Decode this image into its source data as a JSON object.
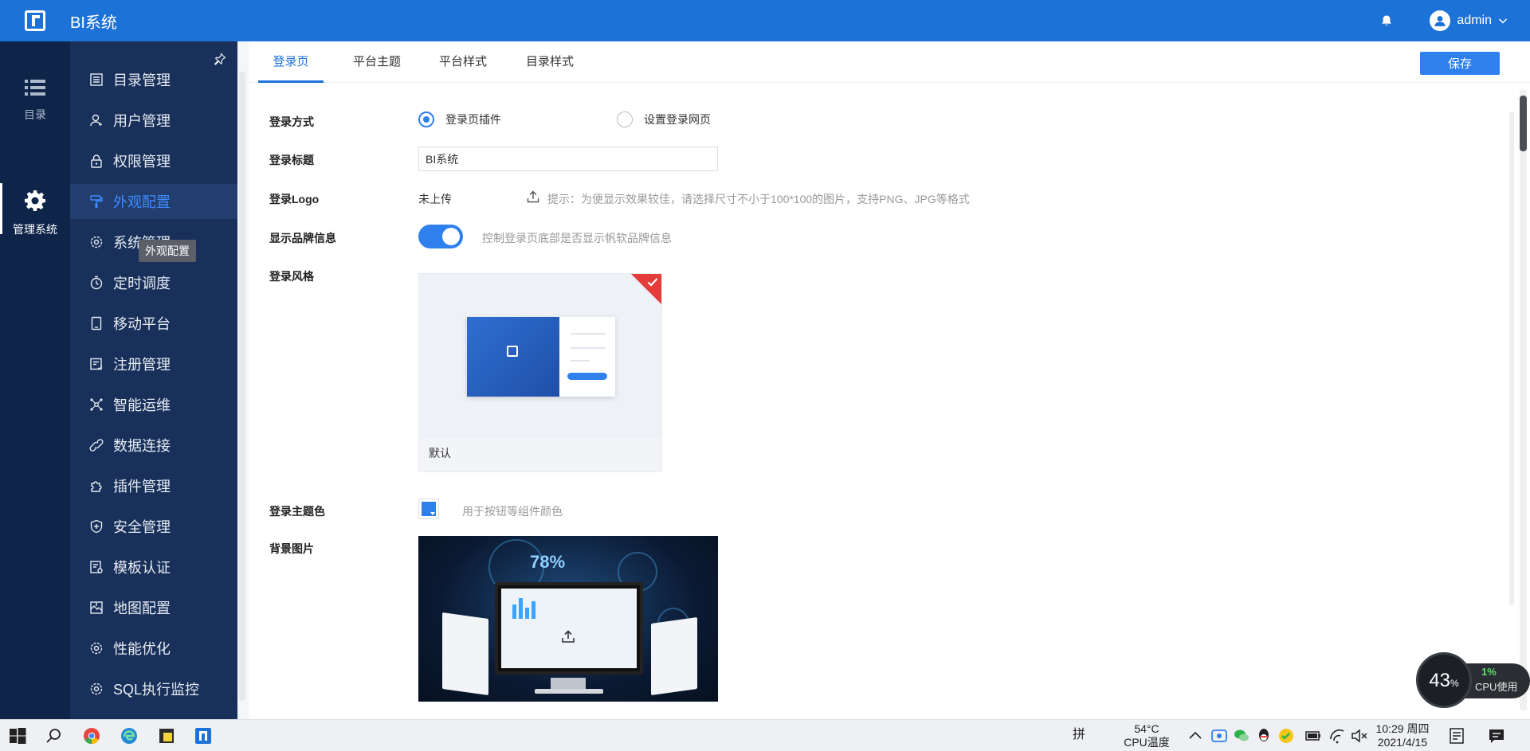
{
  "header": {
    "app_title": "BI系统",
    "user_name": "admin"
  },
  "rail": {
    "items": [
      {
        "label": "目录",
        "icon": "list-icon"
      },
      {
        "label": "管理系统",
        "icon": "gear-icon"
      }
    ]
  },
  "submenu": {
    "items": [
      {
        "label": "目录管理",
        "icon": "catalog-icon"
      },
      {
        "label": "用户管理",
        "icon": "user-icon"
      },
      {
        "label": "权限管理",
        "icon": "lock-icon"
      },
      {
        "label": "外观配置",
        "icon": "brush-icon"
      },
      {
        "label": "系统管理",
        "icon": "gear-icon"
      },
      {
        "label": "定时调度",
        "icon": "timer-icon"
      },
      {
        "label": "移动平台",
        "icon": "mobile-icon"
      },
      {
        "label": "注册管理",
        "icon": "register-icon"
      },
      {
        "label": "智能运维",
        "icon": "network-icon"
      },
      {
        "label": "数据连接",
        "icon": "link-icon"
      },
      {
        "label": "插件管理",
        "icon": "plugin-icon"
      },
      {
        "label": "安全管理",
        "icon": "shield-icon"
      },
      {
        "label": "模板认证",
        "icon": "template-icon"
      },
      {
        "label": "地图配置",
        "icon": "map-icon"
      },
      {
        "label": "性能优化",
        "icon": "gear-icon"
      },
      {
        "label": "SQL执行监控",
        "icon": "gear-icon"
      }
    ],
    "active_index": 3,
    "tooltip": "外观配置"
  },
  "tabs": [
    {
      "label": "登录页"
    },
    {
      "label": "平台主题"
    },
    {
      "label": "平台样式"
    },
    {
      "label": "目录样式"
    }
  ],
  "active_tab": 0,
  "save_label": "保存",
  "form": {
    "login_method": {
      "label": "登录方式",
      "options": [
        "登录页插件",
        "设置登录网页"
      ],
      "selected": 0
    },
    "login_title": {
      "label": "登录标题",
      "value": "BI系统"
    },
    "login_logo": {
      "label": "登录Logo",
      "status": "未上传",
      "hint": "提示：为便显示效果较佳，请选择尺寸不小于100*100的图片，支持PNG、JPG等格式"
    },
    "brand_info": {
      "label": "显示品牌信息",
      "enabled": true,
      "hint": "控制登录页底部是否显示帆软品牌信息"
    },
    "login_style": {
      "label": "登录风格",
      "card_name": "默认"
    },
    "theme_color": {
      "label": "登录主题色",
      "color": "#2f80ed",
      "hint": "用于按钮等组件颜色"
    },
    "background": {
      "label": "背景图片",
      "preview_text": "78%"
    }
  },
  "cpu_widget": {
    "temp_percent": "43",
    "pct_symbol": "%",
    "usage": "1%",
    "usage_label": "CPU使用"
  },
  "taskbar": {
    "ime": "拼",
    "cpu_temp": "54°C",
    "cpu_temp_label": "CPU温度",
    "time": "10:29 周四",
    "date": "2021/4/15"
  },
  "colors": {
    "header_bg": "#1d72d8",
    "rail_bg": "#0e2449",
    "submenu_bg": "#18305a",
    "accent": "#2f80ed"
  }
}
